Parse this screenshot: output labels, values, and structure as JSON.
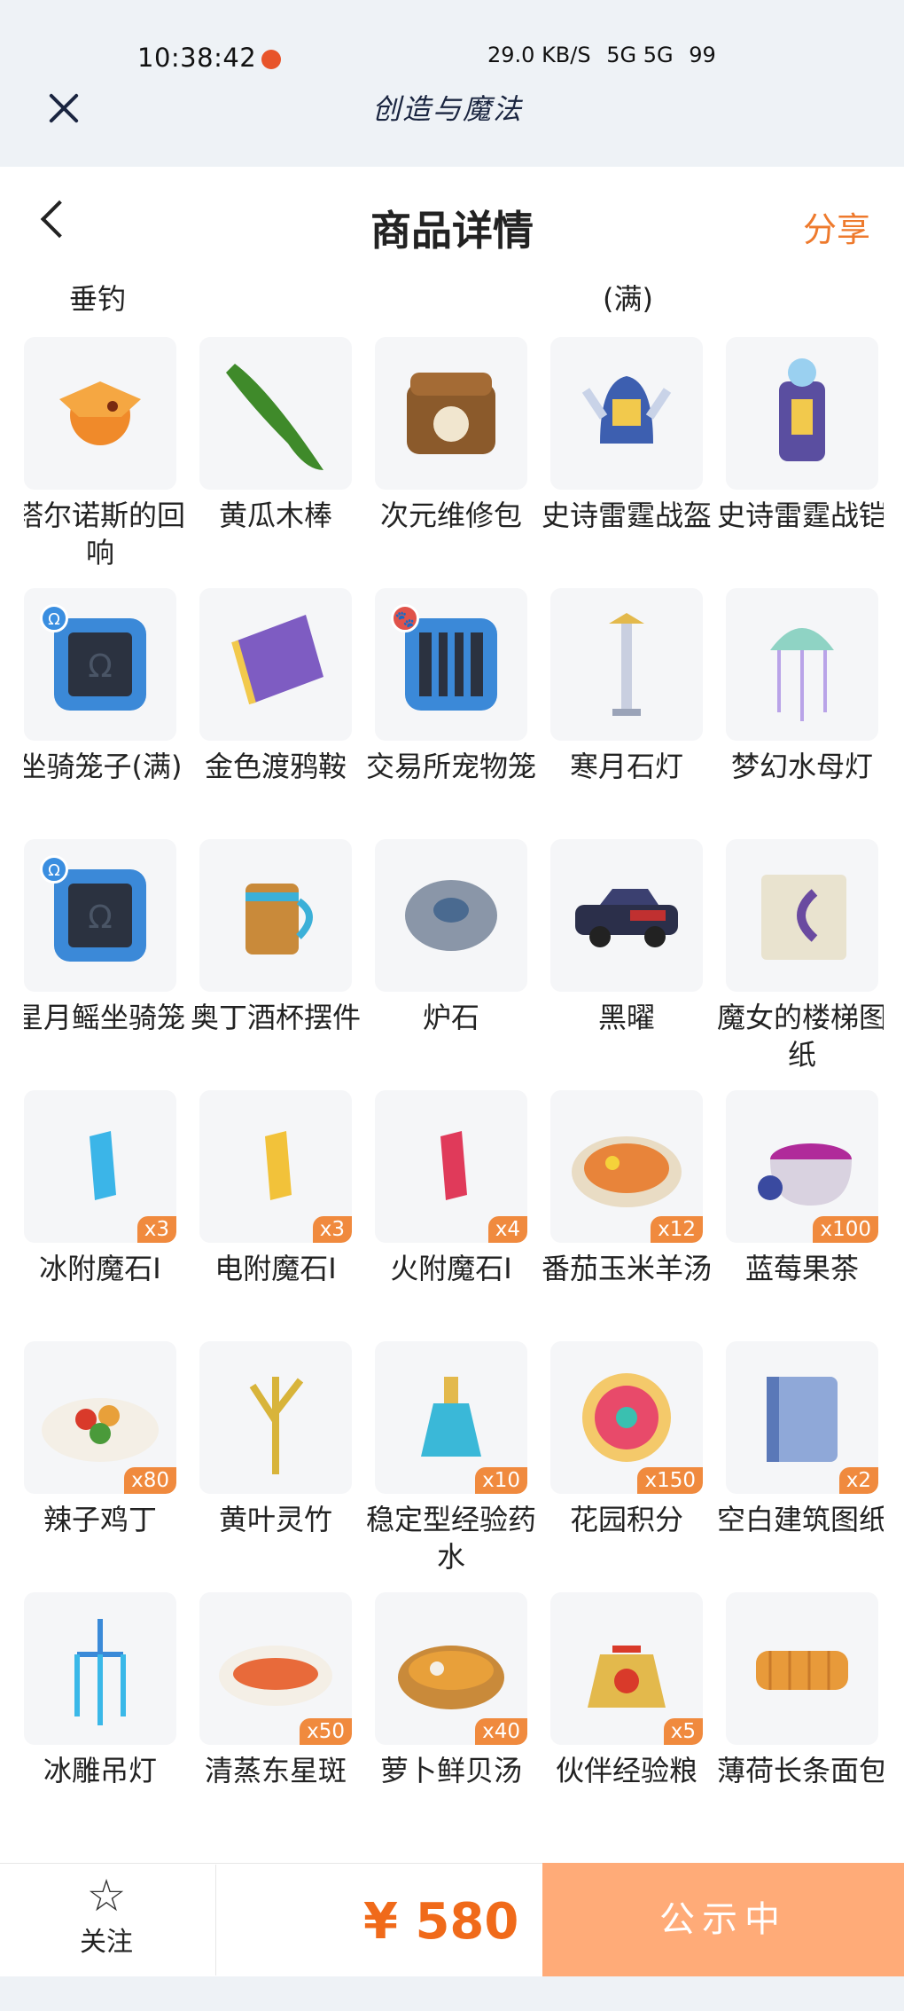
{
  "status_bar": {
    "time": "10:38:42",
    "net_speed": "29.0 KB/S",
    "signal": "5G 5G",
    "battery": "99"
  },
  "app": {
    "name": "创造与魔法"
  },
  "header": {
    "title": "商品详情",
    "share": "分享"
  },
  "partial_row": {
    "left_label": "垂钓",
    "right_label": "(满)"
  },
  "items": [
    {
      "name": "塔尔诺斯的回响",
      "qty": "",
      "icon": "dragon-icon"
    },
    {
      "name": "黄瓜木棒",
      "qty": "",
      "icon": "cucumber-icon"
    },
    {
      "name": "次元维修包",
      "qty": "",
      "icon": "repair-bag-icon"
    },
    {
      "name": "史诗雷霆战盔",
      "qty": "",
      "icon": "helmet-icon"
    },
    {
      "name": "史诗雷霆战铠",
      "qty": "",
      "icon": "armor-icon"
    },
    {
      "name": "坐骑笼子(满)",
      "qty": "",
      "icon": "mount-cage-icon",
      "badge": "Ω"
    },
    {
      "name": "金色渡鸦鞍",
      "qty": "",
      "icon": "saddle-icon"
    },
    {
      "name": "交易所宠物笼",
      "qty": "",
      "icon": "pet-cage-icon",
      "badge": "🐾"
    },
    {
      "name": "寒月石灯",
      "qty": "",
      "icon": "stone-lamp-icon"
    },
    {
      "name": "梦幻水母灯",
      "qty": "",
      "icon": "jellyfish-lamp-icon"
    },
    {
      "name": "星月鳐坐骑笼",
      "qty": "",
      "icon": "mount-cage-icon",
      "badge": "Ω"
    },
    {
      "name": "奥丁酒杯摆件",
      "qty": "",
      "icon": "mug-icon"
    },
    {
      "name": "炉石",
      "qty": "",
      "icon": "hearthstone-icon"
    },
    {
      "name": "黑曜",
      "qty": "",
      "icon": "car-icon"
    },
    {
      "name": "魔女的楼梯图纸",
      "qty": "",
      "icon": "blueprint-icon"
    },
    {
      "name": "冰附魔石I",
      "qty": "x3",
      "icon": "ice-crystal-icon"
    },
    {
      "name": "电附魔石I",
      "qty": "x3",
      "icon": "electric-crystal-icon"
    },
    {
      "name": "火附魔石I",
      "qty": "x4",
      "icon": "fire-crystal-icon"
    },
    {
      "name": "番茄玉米羊汤",
      "qty": "x12",
      "icon": "soup-bowl-icon"
    },
    {
      "name": "蓝莓果茶",
      "qty": "x100",
      "icon": "tea-cup-icon"
    },
    {
      "name": "辣子鸡丁",
      "qty": "x80",
      "icon": "chicken-dish-icon"
    },
    {
      "name": "黄叶灵竹",
      "qty": "",
      "icon": "bamboo-icon"
    },
    {
      "name": "稳定型经验药水",
      "qty": "x10",
      "icon": "potion-icon"
    },
    {
      "name": "花园积分",
      "qty": "x150",
      "icon": "flower-badge-icon"
    },
    {
      "name": "空白建筑图纸",
      "qty": "x2",
      "icon": "paper-roll-icon"
    },
    {
      "name": "冰雕吊灯",
      "qty": "",
      "icon": "chandelier-icon"
    },
    {
      "name": "清蒸东星斑",
      "qty": "x50",
      "icon": "fish-dish-icon"
    },
    {
      "name": "萝卜鲜贝汤",
      "qty": "x40",
      "icon": "seafood-soup-icon"
    },
    {
      "name": "伙伴经验粮",
      "qty": "x5",
      "icon": "food-bag-icon"
    },
    {
      "name": "薄荷长条面包",
      "qty": "",
      "icon": "bread-icon"
    }
  ],
  "footer": {
    "follow_label": "关注",
    "price": "¥ 580",
    "status_button": "公示中"
  },
  "colors": {
    "accent": "#ee7a2d",
    "button": "#ffab78",
    "qty_badge": "#f08a3e"
  }
}
